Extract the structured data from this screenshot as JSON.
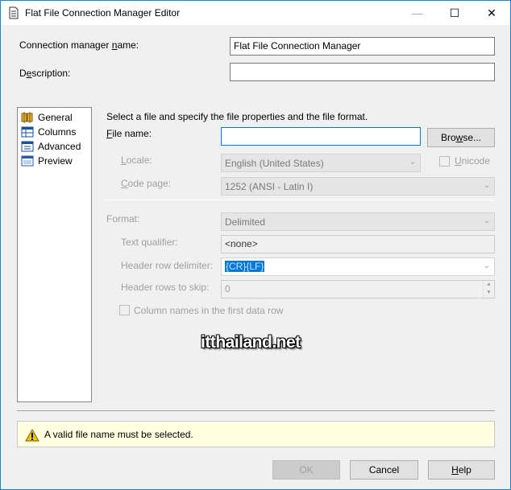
{
  "window": {
    "title": "Flat File Connection Manager Editor",
    "minimize_label": "—",
    "maximize_label": "☐",
    "close_label": "✕"
  },
  "header": {
    "name_label_pre": "Connection manager ",
    "name_label_ul": "n",
    "name_label_post": "ame:",
    "name_value": "Flat File Connection Manager",
    "desc_label_pre": "D",
    "desc_label_ul": "e",
    "desc_label_post": "scription:",
    "desc_value": ""
  },
  "nav": {
    "items": [
      {
        "label": "General",
        "icon": "general-icon"
      },
      {
        "label": "Columns",
        "icon": "columns-icon"
      },
      {
        "label": "Advanced",
        "icon": "advanced-icon"
      },
      {
        "label": "Preview",
        "icon": "preview-icon"
      }
    ]
  },
  "general": {
    "instructions": "Select a file and specify the file properties and the file format.",
    "file_name_label_ul": "F",
    "file_name_label_post": "ile name:",
    "file_name_value": "",
    "browse_label_pre": "Bro",
    "browse_label_ul": "w",
    "browse_label_post": "se...",
    "locale_label_ul": "L",
    "locale_label_post": "ocale:",
    "locale_value": "English (United States)",
    "unicode_label_ul": "U",
    "unicode_label_post": "nicode",
    "codepage_label_ul": "C",
    "codepage_label_post": "ode page:",
    "codepage_value": "1252  (ANSI - Latin I)",
    "format_label": "Format:",
    "format_value": "Delimited",
    "text_qualifier_label": "Text qualifier:",
    "text_qualifier_value": "<none>",
    "header_row_delim_label": "Header row delimiter:",
    "header_row_delim_value": "{CR}{LF}",
    "header_rows_skip_label": "Header rows to skip:",
    "header_rows_skip_value": "0",
    "column_names_label": "Column names in the first data row"
  },
  "watermark": "itthailand.net",
  "status": {
    "message": "A valid file name must be selected."
  },
  "footer": {
    "ok_label": "OK",
    "cancel_label": "Cancel",
    "help_label_ul": "H",
    "help_label_post": "elp"
  }
}
